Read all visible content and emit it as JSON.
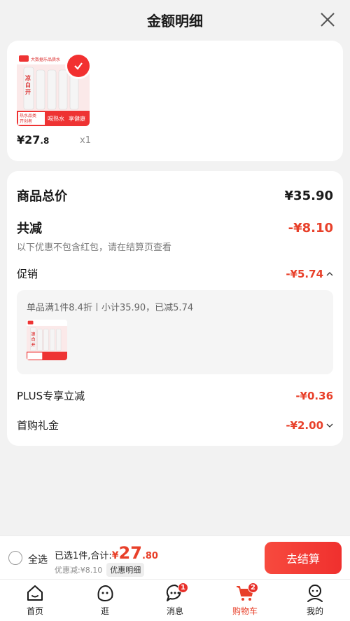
{
  "header": {
    "title": "金额明细"
  },
  "product": {
    "price_main": "¥27",
    "price_decimal": ".8",
    "quantity": "x1",
    "image": {
      "top_banner": "大数据乐品质水",
      "brand": "凉白开",
      "tag_left_1": "热水品类",
      "tag_left_2": "开创者",
      "tag_right_1": "喝熟水",
      "tag_right_2": "享健康"
    }
  },
  "detail": {
    "total_label": "商品总价",
    "total_value": "¥35.90",
    "reduce_label": "共减",
    "reduce_value": "-¥8.10",
    "reduce_note": "以下优惠不包含红包，请在结算页查看",
    "promo_label": "促销",
    "promo_value": "-¥5.74",
    "promo_desc": "单品满1件8.4折丨小计35.90，已减5.74",
    "plus_label": "PLUS专享立减",
    "plus_value": "-¥0.36",
    "first_label": "首购礼金",
    "first_value": "-¥2.00"
  },
  "bottom": {
    "select_all": "全选",
    "selected_text": "已选1件,合计:",
    "total_currency": "¥",
    "total_int": "27",
    "total_dec": ".80",
    "discount_text": "优惠减:¥8.10",
    "detail_chip": "优惠明细",
    "checkout": "去结算"
  },
  "tabs": [
    {
      "label": "首页",
      "icon": "home-icon"
    },
    {
      "label": "逛",
      "icon": "browse-icon"
    },
    {
      "label": "消息",
      "icon": "message-icon",
      "badge": "1"
    },
    {
      "label": "购物车",
      "icon": "cart-icon",
      "badge": "2",
      "active": true
    },
    {
      "label": "我的",
      "icon": "profile-icon"
    }
  ],
  "colors": {
    "accent": "#e8402a",
    "button": "#f23030"
  }
}
